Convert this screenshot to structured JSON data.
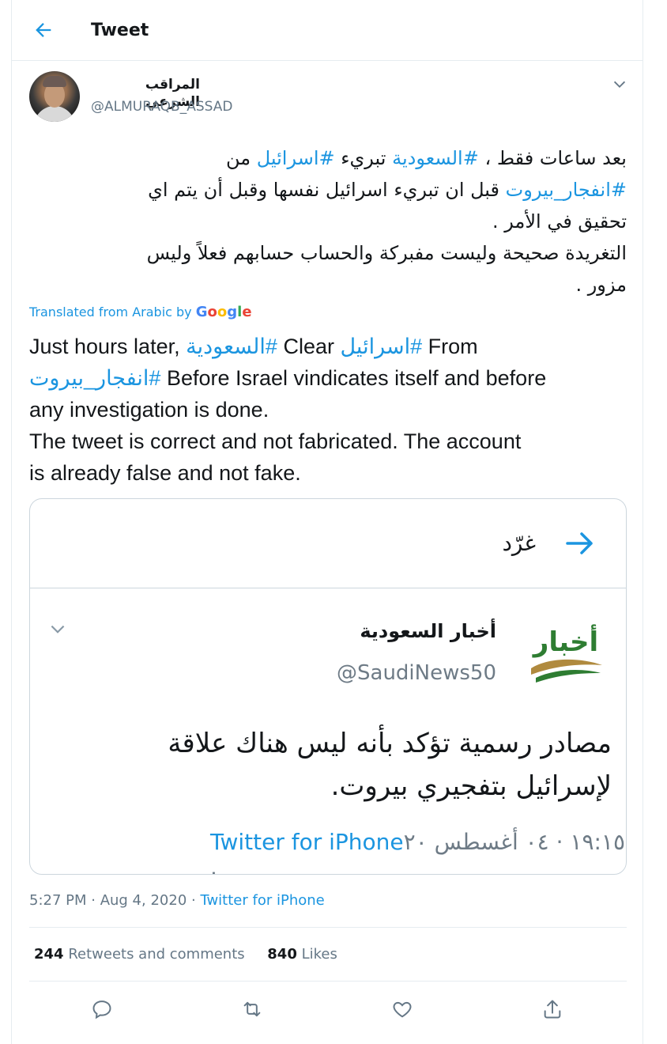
{
  "header": {
    "title": "Tweet"
  },
  "author": {
    "display_name": "المراقب الشرعي",
    "handle": "@ALMURAQB_ASSAD"
  },
  "tweet": {
    "ar_line1_a": "بعد ساعات فقط ، ",
    "ar_line1_hash1": "#السعودية",
    "ar_line1_b": " تبريء ",
    "ar_line1_hash2": "#اسرائيل",
    "ar_line1_c": " من",
    "ar_line2_hash": "#انفجار_بيروت",
    "ar_line2_text": " قبل ان تبريء اسرائيل نفسها وقبل أن يتم اي",
    "ar_line3": "تحقيق في الأمر .",
    "ar_line4": "التغريدة صحيحة وليست مفبركة والحساب حسابهم فعلاً وليس",
    "ar_line5": "مزور .",
    "translated_label": "Translated from Arabic by",
    "google": [
      "G",
      "o",
      "o",
      "g",
      "l",
      "e"
    ],
    "en_1a": "Just hours later, ",
    "en_1_hash1": "السعودية#",
    "en_1b": " Clear ",
    "en_1_hash2": "اسرائيل#",
    "en_1c": " From",
    "en_2_hash": "انفجار_بيروت#",
    "en_2b": " Before Israel vindicates itself and before",
    "en_3": "any investigation is done.",
    "en_4": " The tweet is correct and not fabricated. The account",
    "en_5": "is already false and not fake."
  },
  "embedded": {
    "top_label": "غرّد",
    "name": "أخبار السعودية",
    "handle": "@SaudiNews50",
    "logo_text": "أخبار",
    "text_line1": "مصادر رسمية تؤكد بأنه ليس هناك علاقة",
    "text_line2": "لإسرائيل بتفجيري بيروت.",
    "meta_date": "١٩:١٥ · ٠٤ أغسطس ٢٠ · ",
    "meta_source": "Twitter for iPhone"
  },
  "meta": {
    "time": "5:27 PM · Aug 4, 2020 · ",
    "source": "Twitter for iPhone"
  },
  "stats": {
    "retweets_count": "244",
    "retweets_label": "Retweets and comments",
    "likes_count": "840",
    "likes_label": "Likes"
  },
  "icons": [
    "back-arrow-icon",
    "chevron-down-icon",
    "arrow-right-icon",
    "reply-icon",
    "retweet-icon",
    "like-icon",
    "share-icon"
  ],
  "colors": {
    "accent": "#1b95e0",
    "muted": "#657786",
    "border": "#e6ecf0"
  }
}
